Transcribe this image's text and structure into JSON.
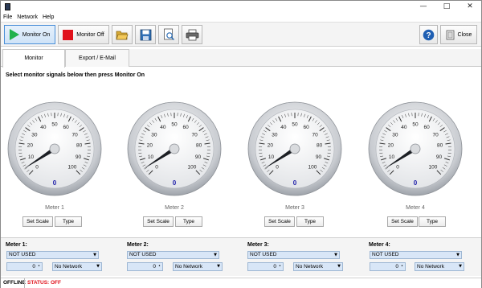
{
  "menu": [
    "File",
    "Network",
    "Help"
  ],
  "toolbar": {
    "monitor_on": "Monitor On",
    "monitor_off": "Monitor Off",
    "close": "Close"
  },
  "tabs": [
    "Monitor",
    "Export / E-Mail"
  ],
  "instruction": "Select monitor signals below then press Monitor On",
  "gauge_ticks": [
    "0",
    "10",
    "20",
    "30",
    "40",
    "50",
    "60",
    "70",
    "80",
    "90",
    "100"
  ],
  "meters": [
    {
      "label": "Meter 1",
      "title": "Meter 1:",
      "value": "0",
      "signal": "NOT USED",
      "offset": "0",
      "network": "No Network",
      "set_scale": "Set Scale",
      "type": "Type"
    },
    {
      "label": "Meter 2",
      "title": "Meter 2:",
      "value": "0",
      "signal": "NOT USED",
      "offset": "0",
      "network": "No Network",
      "set_scale": "Set Scale",
      "type": "Type"
    },
    {
      "label": "Meter 3",
      "title": "Meter 3:",
      "value": "0",
      "signal": "NOT USED",
      "offset": "0",
      "network": "No Network",
      "set_scale": "Set Scale",
      "type": "Type"
    },
    {
      "label": "Meter 4",
      "title": "Meter 4:",
      "value": "0",
      "signal": "NOT USED",
      "offset": "0",
      "network": "No Network",
      "set_scale": "Set Scale",
      "type": "Type"
    }
  ],
  "status": {
    "offline": "OFFLINE",
    "status_text": "STATUS: OFF"
  },
  "colors": {
    "accent": "#4a8fd8",
    "play": "#21b24b",
    "stop": "#e0111b",
    "status_off": "#e0111b",
    "gauge_value": "#1a1aa8"
  }
}
